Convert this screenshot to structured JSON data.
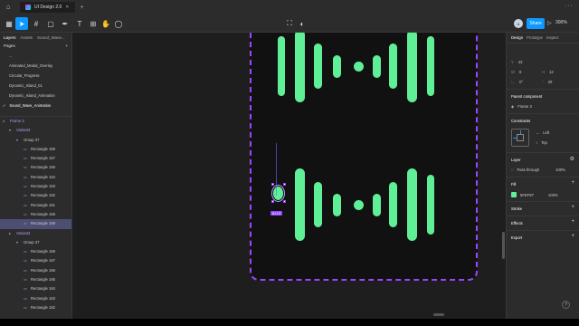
{
  "titlebar": {
    "tab_title": "UI Design 2.0",
    "plus": "+",
    "dots": "···"
  },
  "toolbar": {
    "share_label": "Share",
    "avatar_initials": "A",
    "zoom": "300%"
  },
  "left_panel": {
    "tabs": [
      "Layers",
      "Assets",
      "Sound_Wave..."
    ],
    "pages_header": "Pages",
    "pages": [
      "...",
      "Animated_Modal_Overlay",
      "Circular_Progress",
      "Dynamic_Island_01",
      "Dynamic_Island_Animation",
      "Sound_Wave_Animation"
    ],
    "current_page_index": 5,
    "layers": [
      {
        "label": "Frame 3",
        "indent": 3,
        "purple": true,
        "icon": "#"
      },
      {
        "label": "Variant3",
        "indent": 10,
        "purple": true,
        "icon": "▾"
      },
      {
        "label": "Group 37",
        "indent": 18,
        "purple": false,
        "icon": "▾"
      },
      {
        "label": "Rectangle 168",
        "indent": 26,
        "purple": false,
        "icon": "▭"
      },
      {
        "label": "Rectangle 167",
        "indent": 26,
        "purple": false,
        "icon": "▭"
      },
      {
        "label": "Rectangle 166",
        "indent": 26,
        "purple": false,
        "icon": "▭"
      },
      {
        "label": "Rectangle 164",
        "indent": 26,
        "purple": false,
        "icon": "▭"
      },
      {
        "label": "Rectangle 163",
        "indent": 26,
        "purple": false,
        "icon": "▭"
      },
      {
        "label": "Rectangle 162",
        "indent": 26,
        "purple": false,
        "icon": "▭"
      },
      {
        "label": "Rectangle 161",
        "indent": 26,
        "purple": false,
        "icon": "▭"
      },
      {
        "label": "Rectangle 158",
        "indent": 26,
        "purple": false,
        "icon": "▭"
      },
      {
        "label": "Rectangle 159",
        "indent": 26,
        "purple": false,
        "icon": "▭",
        "selected": true
      },
      {
        "label": "Variant2",
        "indent": 10,
        "purple": true,
        "icon": "▸"
      },
      {
        "label": "Group 37",
        "indent": 18,
        "purple": false,
        "icon": "▾"
      },
      {
        "label": "Rectangle 168",
        "indent": 26,
        "purple": false,
        "icon": "▭"
      },
      {
        "label": "Rectangle 167",
        "indent": 26,
        "purple": false,
        "icon": "▭"
      },
      {
        "label": "Rectangle 166",
        "indent": 26,
        "purple": false,
        "icon": "▭"
      },
      {
        "label": "Rectangle 165",
        "indent": 26,
        "purple": false,
        "icon": "▭"
      },
      {
        "label": "Rectangle 164",
        "indent": 26,
        "purple": false,
        "icon": "▭"
      },
      {
        "label": "Rectangle 163",
        "indent": 26,
        "purple": false,
        "icon": "▭"
      },
      {
        "label": "Rectangle 162",
        "indent": 26,
        "purple": false,
        "icon": "▭"
      }
    ]
  },
  "canvas": {
    "wave_color": "#5FEF97",
    "frame_stroke_color": "#9747FF",
    "selection_label": "8×13"
  },
  "right_panel": {
    "tabs": [
      "Design",
      "Prototype",
      "Inspect"
    ],
    "w_value": "8",
    "h_value": "12",
    "x_value": "8",
    "y_value": "43",
    "rotation": "0°",
    "radius": "20",
    "parent_component_title": "Parent component",
    "parent_component_value": "Frame 3",
    "constraints_title": "Constraints",
    "constraint_h": "Left",
    "constraint_v": "Top",
    "layer_title": "Layer",
    "blend_mode": "Pass through",
    "layer_opacity": "100%",
    "fill_title": "Fill",
    "fill_hex": "5FEF97",
    "fill_opacity": "100%",
    "stroke_title": "Stroke",
    "effects_title": "Effects",
    "export_title": "Export"
  },
  "help": "?"
}
